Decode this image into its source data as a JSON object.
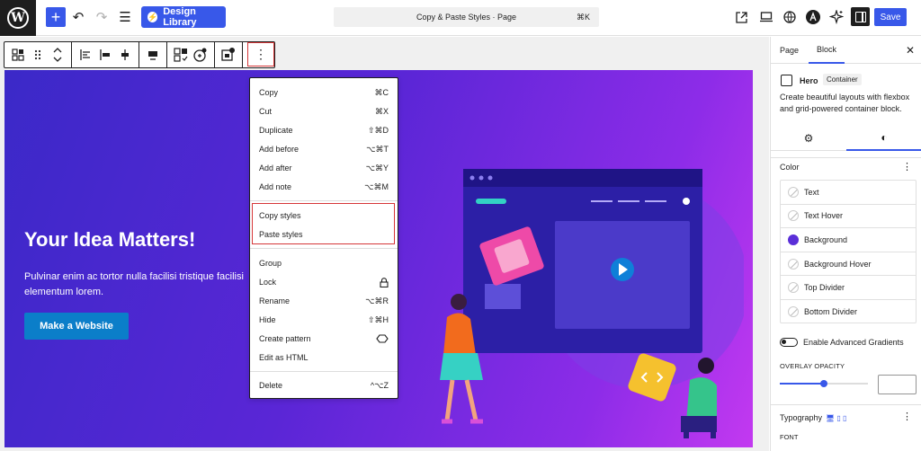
{
  "topbar": {
    "logo": "W",
    "add_icon": "+",
    "undo_icon": "↶",
    "redo_icon": "↷",
    "list_view_icon": "☰",
    "design_library_label": "Design Library",
    "design_library_icon": "⚡",
    "command_bar_text": "Copy & Paste Styles · Page",
    "command_shortcut": "⌘K",
    "save_label": "Save",
    "icons": [
      "external-link-icon",
      "desktop-preview-icon",
      "globe-icon",
      "astra-icon",
      "sparkle-icon",
      "sidebar-toggle-icon"
    ]
  },
  "block_toolbar": {
    "more_icon": "⋮"
  },
  "hero": {
    "title": "Your Idea Matters!",
    "text": "Pulvinar enim ac tortor nulla facilisi tristique facilisi elementum lorem.",
    "button_label": "Make a Website"
  },
  "context_menu": {
    "group1": [
      {
        "label": "Copy",
        "shortcut": "⌘C"
      },
      {
        "label": "Cut",
        "shortcut": "⌘X"
      },
      {
        "label": "Duplicate",
        "shortcut": "⇧⌘D"
      },
      {
        "label": "Add before",
        "shortcut": "⌥⌘T"
      },
      {
        "label": "Add after",
        "shortcut": "⌥⌘Y"
      },
      {
        "label": "Add note",
        "shortcut": "⌥⌘M"
      }
    ],
    "group2": [
      {
        "label": "Copy styles",
        "shortcut": ""
      },
      {
        "label": "Paste styles",
        "shortcut": ""
      }
    ],
    "group3": [
      {
        "label": "Group",
        "shortcut": ""
      },
      {
        "label": "Lock",
        "shortcut": "🔒"
      },
      {
        "label": "Rename",
        "shortcut": "⌥⌘R"
      },
      {
        "label": "Hide",
        "shortcut": "⇧⌘H"
      },
      {
        "label": "Create pattern",
        "shortcut": "◇"
      },
      {
        "label": "Edit as HTML",
        "shortcut": ""
      }
    ],
    "group4": [
      {
        "label": "Delete",
        "shortcut": "^⌥Z"
      }
    ]
  },
  "sidebar": {
    "tab_page": "Page",
    "tab_block": "Block",
    "close_icon": "✕",
    "block_name": "Hero",
    "block_badge": "Container",
    "block_description": "Create beautiful layouts with flexbox and grid-powered container block.",
    "settings_icon": "⚙",
    "styles_icon": "◐",
    "color_title": "Color",
    "more_icon": "⋮",
    "colors": [
      {
        "label": "Text",
        "swatch": "empty"
      },
      {
        "label": "Text Hover",
        "swatch": "empty"
      },
      {
        "label": "Background",
        "swatch": "#5a2fd8"
      },
      {
        "label": "Background Hover",
        "swatch": "empty"
      },
      {
        "label": "Top Divider",
        "swatch": "empty"
      },
      {
        "label": "Bottom Divider",
        "swatch": "empty"
      }
    ],
    "gradient_toggle_label": "Enable Advanced Gradients",
    "gradient_toggle_on": false,
    "overlay_label": "OVERLAY OPACITY",
    "overlay_value": 0.5,
    "typography_title": "Typography",
    "typography_icons": "🖥 ▯ ▯",
    "font_label": "FONT"
  }
}
